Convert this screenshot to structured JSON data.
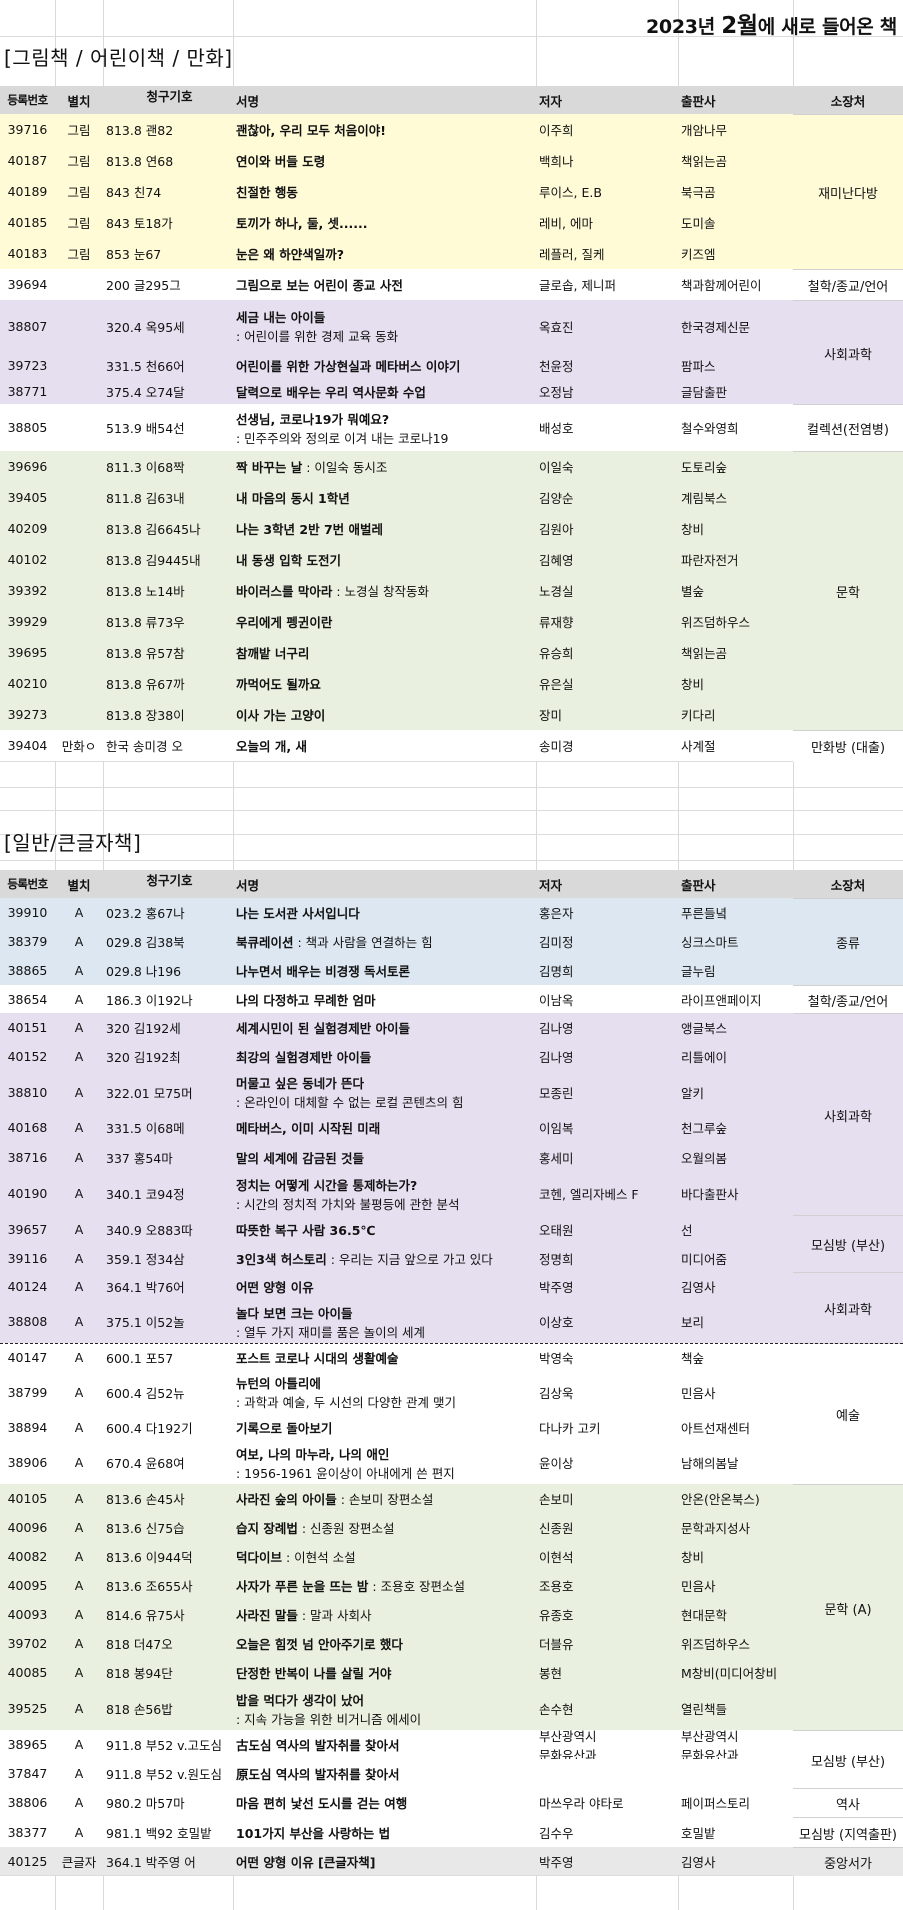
{
  "title": {
    "prefix": "2023년 ",
    "month": "2월",
    "suffix": "에 새로 들어온 책"
  },
  "headers": {
    "id": "등록번호",
    "sep": "별치",
    "call": "청구기호",
    "title": "서명",
    "author": "저자",
    "pub": "출판사",
    "loc": "소장처"
  },
  "colors": {
    "yellow": "#fffbd6",
    "purple": "#e5dff0",
    "green": "#eaf0df",
    "blue": "#dde7f1",
    "header": "#d9d9d9"
  },
  "sections": [
    {
      "name": "[그림책 / 어린이책 / 만화]",
      "rows": [
        {
          "id": "39716",
          "sep": "그림",
          "call": "813.8 괜82",
          "title": "괜찮아, 우리 모두 처음이야!",
          "author": "이주희",
          "pub": "개암나무"
        },
        {
          "id": "40187",
          "sep": "그림",
          "call": "813.8 연68",
          "title": "연이와 버들 도령",
          "author": "백희나",
          "pub": "책읽는곰"
        },
        {
          "id": "40189",
          "sep": "그림",
          "call": "843 친74",
          "title": "친절한 행동",
          "author": "루이스, E.B",
          "pub": "북극곰"
        },
        {
          "id": "40185",
          "sep": "그림",
          "call": "843 토18가",
          "title": "토끼가 하나, 둘, 셋......",
          "author": "레비, 에마",
          "pub": "도미솔"
        },
        {
          "id": "40183",
          "sep": "그림",
          "call": "853 눈67",
          "title": "눈은 왜 하얀색일까?",
          "author": "레플러, 질케",
          "pub": "키즈엠"
        },
        {
          "id": "39694",
          "sep": "",
          "call": "200 글295그",
          "title": "그림으로 보는 어린이 종교 사전",
          "author": "글로솝, 제니퍼",
          "pub": "책과함께어린이"
        },
        {
          "id": "38807",
          "sep": "",
          "call": "320.4 옥95세",
          "title": "세금 내는 아이들",
          "title2": ": 어린이를 위한 경제 교육 동화",
          "author": "옥효진",
          "pub": "한국경제신문"
        },
        {
          "id": "39723",
          "sep": "",
          "call": "331.5 천66어",
          "title": "어린이를 위한 가상현실과 메타버스 이야기",
          "author": "천윤정",
          "pub": "팜파스"
        },
        {
          "id": "38771",
          "sep": "",
          "call": "375.4 오74달",
          "title": "달력으로 배우는 우리 역사문화 수업",
          "author": "오정남",
          "pub": "글담출판"
        },
        {
          "id": "38805",
          "sep": "",
          "call": "513.9 배54선",
          "title": "선생님, 코로나19가 뭐예요?",
          "title2": ": 민주주의와 정의로 이겨 내는 코로나19",
          "author": "배성호",
          "pub": "철수와영희"
        },
        {
          "id": "39696",
          "sep": "",
          "call": "811.3 이68짝",
          "title": "짝 바꾸는 날",
          "sub": " : 이일숙 동시조",
          "author": "이일숙",
          "pub": "도토리숲"
        },
        {
          "id": "39405",
          "sep": "",
          "call": "811.8 김63내",
          "title": "내 마음의 동시 1학년",
          "author": "김양순",
          "pub": "계림북스"
        },
        {
          "id": "40209",
          "sep": "",
          "call": "813.8 김6645나",
          "title": "나는 3학년 2반 7번 애벌레",
          "author": "김원아",
          "pub": "창비"
        },
        {
          "id": "40102",
          "sep": "",
          "call": "813.8 김9445내",
          "title": "내 동생 입학 도전기",
          "author": "김혜영",
          "pub": "파란자전거"
        },
        {
          "id": "39392",
          "sep": "",
          "call": "813.8 노14바",
          "title": "바이러스를 막아라",
          "sub": " : 노경실 창작동화",
          "author": "노경실",
          "pub": "별숲"
        },
        {
          "id": "39929",
          "sep": "",
          "call": "813.8 류73우",
          "title": "우리에게 펭귄이란",
          "author": "류재향",
          "pub": "위즈덤하우스"
        },
        {
          "id": "39695",
          "sep": "",
          "call": "813.8 유57참",
          "title": "참깨밭 너구리",
          "author": "유승희",
          "pub": "책읽는곰"
        },
        {
          "id": "40210",
          "sep": "",
          "call": "813.8 유67까",
          "title": "까먹어도 될까요",
          "author": "유은실",
          "pub": "창비"
        },
        {
          "id": "39273",
          "sep": "",
          "call": "813.8 장38이",
          "title": "이사 가는 고양이",
          "author": "장미",
          "pub": "키다리"
        },
        {
          "id": "39404",
          "sep": "만화ㅇ",
          "call": "한국 송미경 오",
          "title": "오늘의 개, 새",
          "author": "송미경",
          "pub": "사계절"
        }
      ],
      "locations": [
        "재미난다방",
        "철학/종교/언어",
        "사회과학",
        "컬렉션(전염병)",
        "문학",
        "만화방 (대출)"
      ]
    },
    {
      "name": "[일반/큰글자책]",
      "rows": [
        {
          "id": "39910",
          "sep": "A",
          "call": "023.2 홍67나",
          "title": "나는 도서관 사서입니다",
          "author": "홍은자",
          "pub": "푸른들녘"
        },
        {
          "id": "38379",
          "sep": "A",
          "call": "029.8 김38북",
          "title": "북큐레이션",
          "sub": " : 책과 사람을 연결하는 힘",
          "author": "김미정",
          "pub": "싱크스마트"
        },
        {
          "id": "38865",
          "sep": "A",
          "call": "029.8 나196",
          "title": "나누면서 배우는 비경쟁 독서토론",
          "author": "김명희",
          "pub": "글누림"
        },
        {
          "id": "38654",
          "sep": "A",
          "call": "186.3 이192나",
          "title": "나의 다정하고 무례한 엄마",
          "author": "이남옥",
          "pub": "라이프앤페이지"
        },
        {
          "id": "40151",
          "sep": "A",
          "call": "320 김192세",
          "title": "세계시민이 된 실험경제반 아이들",
          "author": "김나영",
          "pub": "앵글북스"
        },
        {
          "id": "40152",
          "sep": "A",
          "call": "320 김192최",
          "title": "최강의 실험경제반 아이들",
          "author": "김나영",
          "pub": "리틀에이"
        },
        {
          "id": "38810",
          "sep": "A",
          "call": "322.01 모75머",
          "title": "머물고 싶은 동네가 뜬다",
          "title2": ": 온라인이 대체할 수 없는 로컬 콘텐츠의 힘",
          "author": "모종린",
          "pub": "알키"
        },
        {
          "id": "40168",
          "sep": "A",
          "call": "331.5 이68메",
          "title": "메타버스, 이미 시작된 미래",
          "author": "이임복",
          "pub": "천그루숲"
        },
        {
          "id": "38716",
          "sep": "A",
          "call": "337 홍54마",
          "title": "말의 세계에 감금된 것들",
          "author": "홍세미",
          "pub": "오월의봄"
        },
        {
          "id": "40190",
          "sep": "A",
          "call": "340.1 코94정",
          "title": "정치는 어떻게 시간을 통제하는가?",
          "title2": ": 시간의 정치적 가치와 불평등에 관한 분석",
          "author": "코헨, 엘리자베스 F",
          "pub": "바다출판사"
        },
        {
          "id": "39657",
          "sep": "A",
          "call": "340.9 오883따",
          "title": "따뜻한 복구 사람 36.5℃",
          "author": "오태원",
          "pub": "선"
        },
        {
          "id": "39116",
          "sep": "A",
          "call": "359.1 정34삼",
          "title": "3인3색 허스토리",
          "sub": " : 우리는 지금 앞으로 가고 있다",
          "author": "정명희",
          "pub": "미디어줌"
        },
        {
          "id": "40124",
          "sep": "A",
          "call": "364.1 박76어",
          "title": "어떤 양형 이유",
          "author": "박주영",
          "pub": "김영사"
        },
        {
          "id": "38808",
          "sep": "A",
          "call": "375.1 이52놀",
          "title": "놀다 보면 크는 아이들",
          "title2": ": 열두 가지 재미를 품은 놀이의 세계",
          "author": "이상호",
          "pub": "보리"
        },
        {
          "id": "40147",
          "sep": "A",
          "call": "600.1 포57",
          "title": "포스트 코로나 시대의 생활예술",
          "author": "박영숙",
          "pub": "책숲"
        },
        {
          "id": "38799",
          "sep": "A",
          "call": "600.4 김52뉴",
          "title": "뉴턴의 아틀리에",
          "title2": ": 과학과 예술, 두 시선의 다양한 관계 맺기",
          "author": "김상욱",
          "pub": "민음사"
        },
        {
          "id": "38894",
          "sep": "A",
          "call": "600.4 다192기",
          "title": "기록으로 돌아보기",
          "author": "다나카 고키",
          "pub": "아트선재센터"
        },
        {
          "id": "38906",
          "sep": "A",
          "call": "670.4 윤68여",
          "title": "여보, 나의 마누라, 나의 애인",
          "title2": ": 1956-1961 윤이상이 아내에게 쓴 편지",
          "author": "윤이상",
          "pub": "남해의봄날"
        },
        {
          "id": "40105",
          "sep": "A",
          "call": "813.6 손45사",
          "title": "사라진 숲의 아이들",
          "sub": " : 손보미 장편소설",
          "author": "손보미",
          "pub": "안온(안온북스)"
        },
        {
          "id": "40096",
          "sep": "A",
          "call": "813.6 신75습",
          "title": "습지 장례법",
          "sub": " : 신종원 장편소설",
          "author": "신종원",
          "pub": "문학과지성사"
        },
        {
          "id": "40082",
          "sep": "A",
          "call": "813.6 이944덕",
          "title": "덕다이브",
          "sub": " : 이현석 소설",
          "author": "이현석",
          "pub": "창비"
        },
        {
          "id": "40095",
          "sep": "A",
          "call": "813.6 조655사",
          "title": "사자가 푸른 눈을 뜨는 밤",
          "sub": " : 조용호 장편소설",
          "author": "조용호",
          "pub": "민음사"
        },
        {
          "id": "40093",
          "sep": "A",
          "call": "814.6 유75사",
          "title": "사라진 말들",
          "sub": " : 말과 사회사",
          "author": "유종호",
          "pub": "현대문학"
        },
        {
          "id": "39702",
          "sep": "A",
          "call": "818 더47오",
          "title": "오늘은 힘껏 넘 안아주기로 했다",
          "author": "더블유",
          "pub": "위즈덤하우스"
        },
        {
          "id": "40085",
          "sep": "A",
          "call": "818 봉94단",
          "title": "단정한 반복이 나를 살릴 거야",
          "author": "봉현",
          "pub": "M창비(미디어창비"
        },
        {
          "id": "39525",
          "sep": "A",
          "call": "818 손56밥",
          "title": "밥을 먹다가 생각이 났어",
          "title2": ": 지속 가능을 위한 비거니즘 에세이",
          "author": "손수현",
          "pub": "열린책들"
        },
        {
          "id": "38965",
          "sep": "A",
          "call": "911.8 부52 v.고도심",
          "title": "古도심 역사의 발자취를 찾아서",
          "author": "부산광역시",
          "author2": "문화유산과",
          "pub": "부산광역시",
          "pub2": "문화유산과"
        },
        {
          "id": "37847",
          "sep": "A",
          "call": "911.8 부52 v.원도심",
          "title": "原도심 역사의 발자취를 찾아서",
          "author": "",
          "pub": ""
        },
        {
          "id": "38806",
          "sep": "A",
          "call": "980.2 마57마",
          "title": "마음 편히 낯선 도시를 걷는 여행",
          "author": "마쓰우라 야타로",
          "pub": "페이퍼스토리"
        },
        {
          "id": "38377",
          "sep": "A",
          "call": "981.1 백92 호밀밭",
          "title": "101가지 부산을 사랑하는 법",
          "author": "김수우",
          "pub": "호밀밭"
        },
        {
          "id": "40125",
          "sep": "큰글자",
          "call": "364.1 박주영 어",
          "title": "어떤 양형 이유 [큰글자책]",
          "author": "박주영",
          "pub": "김영사"
        }
      ],
      "locations": [
        "종류",
        "철학/종교/언어",
        "사회과학",
        "모심방 (부산)",
        "사회과학",
        "예술",
        "문학 (A)",
        "모심방 (부산)",
        "역사",
        "모심방 (지역출판)",
        "중앙서가"
      ]
    }
  ]
}
